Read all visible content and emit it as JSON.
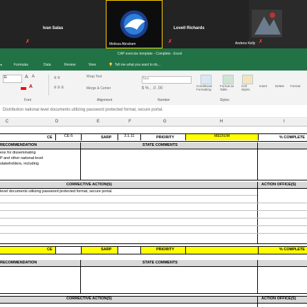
{
  "call": {
    "participants": [
      {
        "name": "Ivan Salas"
      },
      {
        "name": "Melissa Abraham"
      },
      {
        "name": "Lovell Richards"
      },
      {
        "name": "Andrew Kelly"
      }
    ]
  },
  "excel": {
    "title": "CAP exercise template - Complete - Excel",
    "menu": [
      "Formulas",
      "Data",
      "Review",
      "View",
      "Tell me what you want to do..."
    ],
    "ribbon": {
      "font_size": "11",
      "wrap_text": "Wrap Text",
      "merge_center": "Merge & Center",
      "number_format": "Text",
      "groups": [
        "Font",
        "Alignment",
        "Number",
        "Styles"
      ],
      "styles": [
        "Conditional Formatting",
        "Format as Table",
        "Cell Styles",
        "Insert",
        "Delete",
        "Format"
      ]
    },
    "formula_bar": "Distribution national level documents utilizing password protected format, secure portal.",
    "columns": [
      "C",
      "D",
      "E",
      "F",
      "G",
      "H",
      "I"
    ],
    "sheet": {
      "ce_label": "CE",
      "ce_value": "CE-5",
      "sarp_label": "SARP",
      "sarp_value": "3.1.11",
      "priority_label": "PRIORITY",
      "priority_value": "MEDIUM",
      "complete_label": "% COMPLETE",
      "recommendation_label": "RECOMMENDATION",
      "state_comments_label": "STATE COMMENTS",
      "recommendation_text": [
        "ess for disseminating",
        "P and other national-level",
        "stakeholders, including"
      ],
      "corrective_actions_label": "CORRECTIVE ACTION(S)",
      "action_office_label": "ACTION OFFICE(S)",
      "corrective_text": "level documents utilizing password protected format, secure portal.",
      "ce_label_2": "CE",
      "sarp_label_2": "SARP",
      "priority_label_2": "PRIORITY",
      "complete_label_2": "% COMPLETE",
      "recommendation_label_2": "RECOMMENDATION",
      "state_comments_label_2": "STATE COMMENTS",
      "corrective_actions_label_2": "CORRECTIVE ACTION(S)",
      "action_office_label_2": "ACTION OFFICE(S)"
    }
  },
  "colors": {
    "excel_green": "#217346",
    "highlight": "#ffff00",
    "active_speaker": "#ffd400"
  }
}
